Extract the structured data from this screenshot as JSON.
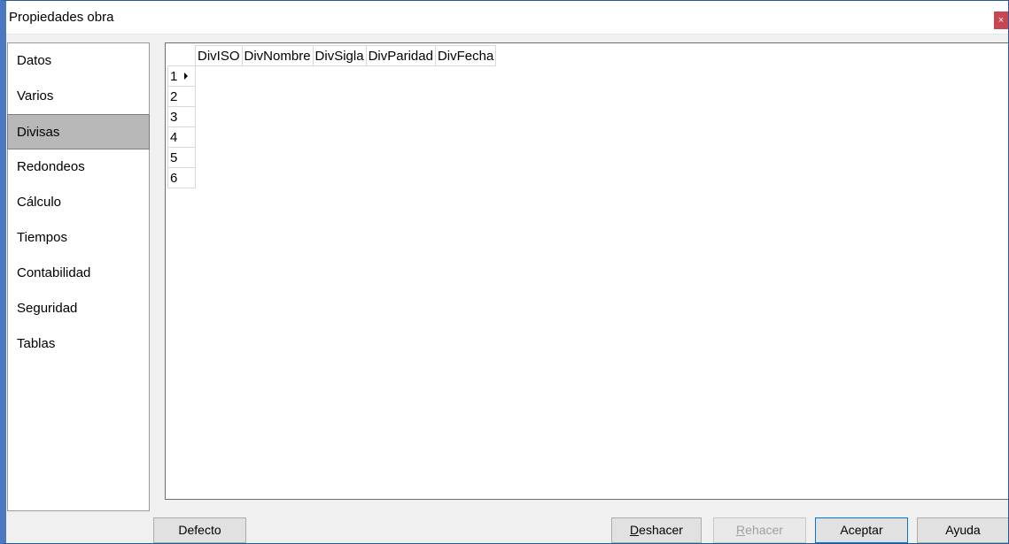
{
  "window": {
    "title": "Propiedades obra",
    "close_glyph": "×"
  },
  "sidebar": {
    "items": [
      {
        "label": "Datos",
        "selected": false
      },
      {
        "label": "Varios",
        "selected": false
      },
      {
        "label": "Divisas",
        "selected": true
      },
      {
        "label": "Redondeos",
        "selected": false
      },
      {
        "label": "Cálculo",
        "selected": false
      },
      {
        "label": "Tiempos",
        "selected": false
      },
      {
        "label": "Contabilidad",
        "selected": false
      },
      {
        "label": "Seguridad",
        "selected": false
      },
      {
        "label": "Tablas",
        "selected": false
      }
    ]
  },
  "grid": {
    "columns": [
      "DivISO",
      "DivNombre",
      "DivSigla",
      "DivParidad",
      "DivFecha"
    ],
    "rows": [
      "1",
      "2",
      "3",
      "4",
      "5",
      "6"
    ],
    "current_row_indicator": "triangle-right-icon"
  },
  "buttons": {
    "defecto": "Defecto",
    "deshacer_accel": "D",
    "deshacer_rest": "eshacer",
    "rehacer_accel": "R",
    "rehacer_rest": "ehacer",
    "aceptar": "Aceptar",
    "ayuda": "Ayuda"
  },
  "colors": {
    "window_border": "#4a78c2",
    "close_button": "#c74652",
    "selected_item": "#b8b8b8",
    "primary_button_border": "#0078d7"
  }
}
